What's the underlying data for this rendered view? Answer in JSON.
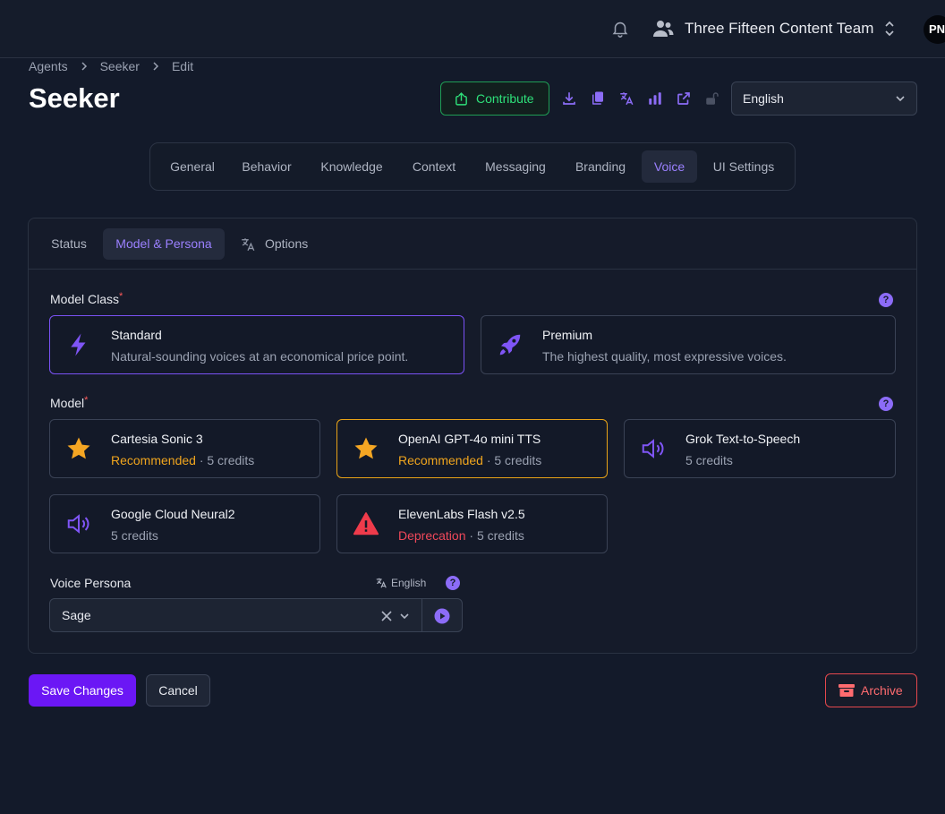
{
  "topbar": {
    "team_name": "Three Fifteen Content Team",
    "avatar_initials": "PN",
    "icons": [
      "bell-icon",
      "users-icon",
      "chevron-updown-icon"
    ]
  },
  "breadcrumb": [
    "Agents",
    "Seeker",
    "Edit"
  ],
  "page_title": "Seeker",
  "toolbar": {
    "contribute_label": "Contribute",
    "language": "English",
    "icons": [
      "download-icon",
      "copy-icon",
      "translate-icon",
      "analytics-icon",
      "external-link-icon",
      "unlock-icon"
    ]
  },
  "main_tabs": [
    "General",
    "Behavior",
    "Knowledge",
    "Context",
    "Messaging",
    "Branding",
    "Voice",
    "UI Settings"
  ],
  "active_main_tab": "Voice",
  "sub_tabs": [
    "Status",
    "Model & Persona",
    "Options"
  ],
  "active_sub_tab": "Model & Persona",
  "model_class": {
    "label": "Model Class",
    "required_mark": "*",
    "options": [
      {
        "title": "Standard",
        "description": "Natural-sounding voices at an economical price point.",
        "icon": "bolt-icon",
        "selected": true
      },
      {
        "title": "Premium",
        "description": "The highest quality, most expressive voices.",
        "icon": "rocket-icon",
        "selected": false
      }
    ]
  },
  "model": {
    "label": "Model",
    "required_mark": "*",
    "options": [
      {
        "title": "Cartesia Sonic 3",
        "tag": "Recommended",
        "credits": " · 5 credits",
        "icon": "star-icon",
        "selected": false
      },
      {
        "title": "OpenAI GPT-4o mini TTS",
        "tag": "Recommended",
        "credits": " · 5 credits",
        "icon": "star-icon",
        "selected": true
      },
      {
        "title": "Grok Text-to-Speech",
        "tag": "",
        "credits": "5 credits",
        "icon": "speaker-icon",
        "selected": false
      },
      {
        "title": "Google Cloud Neural2",
        "tag": "",
        "credits": "5 credits",
        "icon": "speaker-icon",
        "selected": false
      },
      {
        "title": "ElevenLabs Flash v2.5",
        "tag": "Deprecation",
        "credits": " · 5 credits",
        "icon": "warning-icon",
        "selected": false
      }
    ]
  },
  "voice_persona": {
    "label": "Voice Persona",
    "language": "English",
    "value": "Sage"
  },
  "help_glyph": "?",
  "footer": {
    "save_label": "Save Changes",
    "cancel_label": "Cancel",
    "archive_label": "Archive"
  },
  "colors": {
    "accent": "#9b80ff",
    "primary_button": "#6b17f5",
    "success": "#2ee07a",
    "recommended": "#f0a51e",
    "danger": "#f0485a"
  }
}
